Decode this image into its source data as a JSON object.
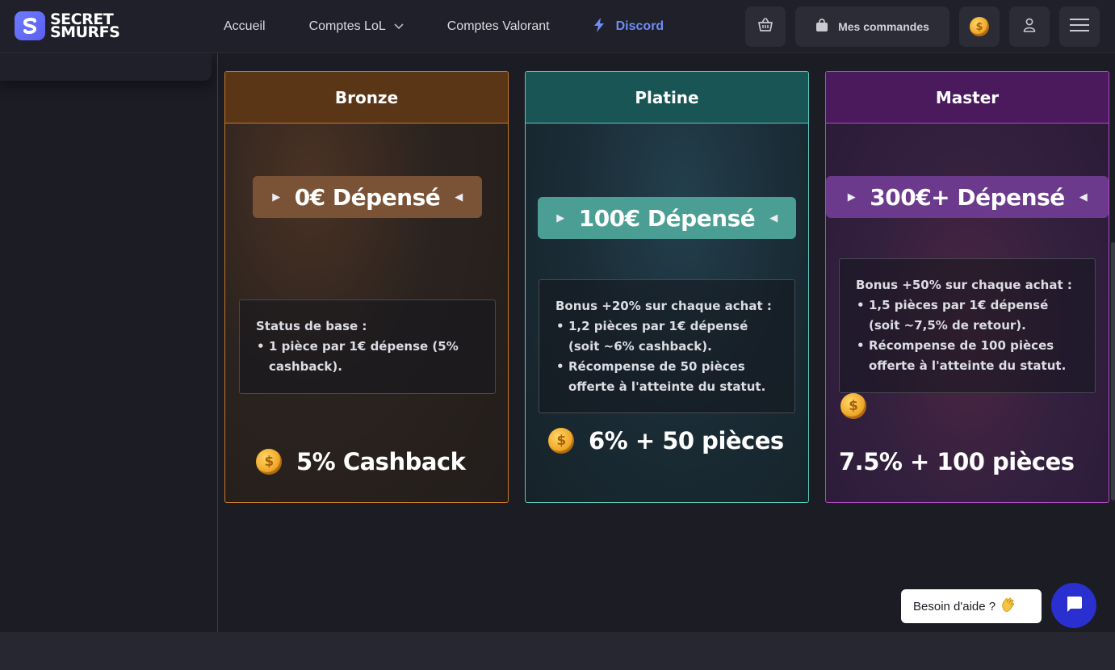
{
  "brand": {
    "line1": "SECRET",
    "line2": "SMURFS"
  },
  "nav": {
    "home": "Accueil",
    "lol": "Comptes LoL",
    "valorant": "Comptes Valorant",
    "discord": "Discord"
  },
  "header": {
    "orders_label": "Mes commandes"
  },
  "tiers": [
    {
      "name": "Bronze",
      "spent": "0€ Dépensé",
      "perk_title": "Status de base :",
      "perks": [
        "1 pièce par 1€ dépense (5% cashback)."
      ],
      "reward": "5% Cashback"
    },
    {
      "name": "Platine",
      "spent": "100€ Dépensé",
      "perk_title": "Bonus +20% sur chaque achat :",
      "perks": [
        "1,2 pièces par 1€ dépensé (soit ~6% cashback).",
        "Récompense de 50 pièces offerte à l'atteinte du statut."
      ],
      "reward": "6% + 50 pièces"
    },
    {
      "name": "Master",
      "spent": "300€+ Dépensé",
      "perk_title": "Bonus +50% sur chaque achat :",
      "perks": [
        "1,5 pièces par 1€ dépensé (soit ~7,5% de retour).",
        "Récompense de 100 pièces offerte à l'atteinte du statut."
      ],
      "reward": "7.5% + 100 pièces"
    }
  ],
  "help": {
    "label": "Besoin d'aide ?"
  },
  "icons": {
    "cart": "basket-icon",
    "orders": "shopping-bag-icon",
    "coins": "coin-icon",
    "user": "user-icon",
    "menu": "hamburger-menu-icon",
    "chat": "chat-bubble-icon",
    "discord": "lightning-icon"
  },
  "colors": {
    "bronze": "#c8792a",
    "platine": "#5cc8b8",
    "master": "#b14ac4",
    "accent": "#6e8cf5",
    "chat": "#2a2fd0"
  }
}
